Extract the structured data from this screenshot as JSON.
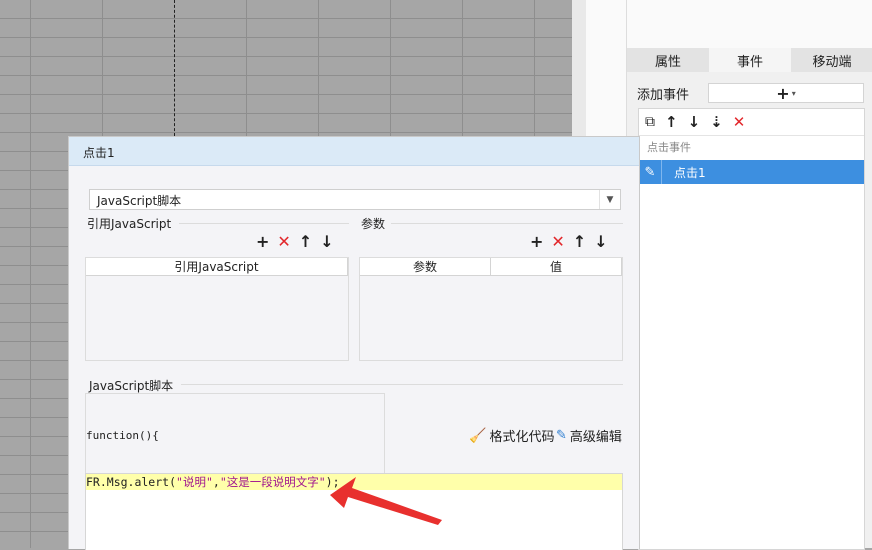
{
  "right_panel": {
    "tabs": [
      "属性",
      "事件",
      "移动端"
    ],
    "active_tab": "事件",
    "add_event_label": "添加事件",
    "add_event_button": "+",
    "event_group_label": "点击事件",
    "events": [
      {
        "label": "点击1",
        "selected": true
      }
    ]
  },
  "dialog": {
    "title": "点击1",
    "script_type": "JavaScript脚本",
    "ref_js_section": "引用JavaScript",
    "params_section": "参数",
    "ref_js_column": "引用JavaScript",
    "params_columns": [
      "参数",
      "值"
    ],
    "script_section": "JavaScript脚本",
    "function_header": "function(){",
    "format_code_label": "格式化代码",
    "advanced_edit_label": "高级编辑",
    "code": {
      "prefix": "FR.Msg.alert(",
      "arg1": "\"说明\"",
      "comma": ",",
      "arg2": "\"这是一段说明文字\"",
      "suffix": ");"
    }
  },
  "colors": {
    "selected_event": "#3d8fe0",
    "delete_red": "#e2272b",
    "code_highlight": "#ffffaa",
    "annotation_arrow": "#e8302e"
  }
}
